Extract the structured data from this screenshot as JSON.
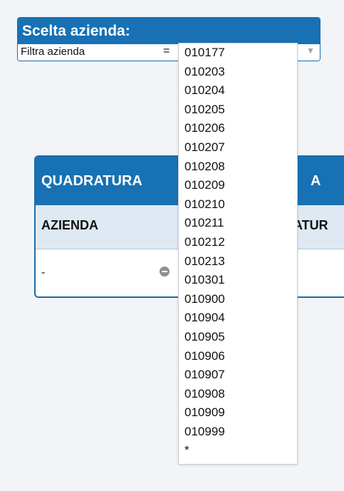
{
  "filter": {
    "title": "Scelta azienda:",
    "label": "Filtra azienda",
    "operator": "=",
    "selected_value": "010177",
    "options": [
      "010177",
      "010203",
      "010204",
      "010205",
      "010206",
      "010207",
      "010208",
      "010209",
      "010210",
      "010211",
      "010212",
      "010213",
      "010301",
      "010900",
      "010904",
      "010905",
      "010906",
      "010907",
      "010908",
      "010909",
      "010999",
      "*"
    ]
  },
  "table": {
    "title": "QUADRATURA",
    "title_suffix": "A",
    "columns": [
      "AZIENDA",
      "ATUR"
    ],
    "rows": [
      {
        "azienda": "-"
      }
    ]
  },
  "colors": {
    "primary": "#1771b4",
    "header_row": "#dfe9f4",
    "background": "#f2f4f8"
  },
  "icons": {
    "dropdown": "chevron-down-icon",
    "row_action": "minus-circle-icon"
  }
}
